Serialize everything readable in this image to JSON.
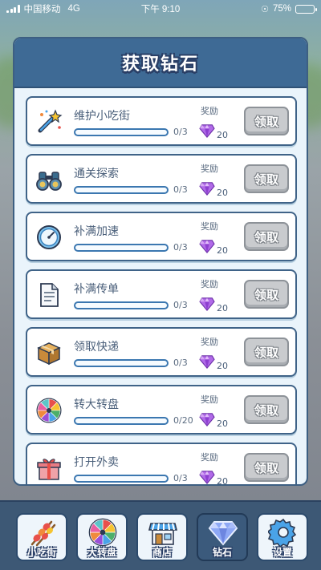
{
  "status_bar": {
    "carrier": "中国移动",
    "network": "4G",
    "time": "下午 9:10",
    "battery": "75%",
    "battery_level": 0.75
  },
  "panel": {
    "title": "获取钻石"
  },
  "tasks": [
    {
      "name": "维护小吃街",
      "progress_text": "0/3",
      "progress": 0,
      "reward_label": "奖励",
      "reward_amount": "20",
      "claim_label": "领取",
      "icon": "magic-wand-icon"
    },
    {
      "name": "通关探索",
      "progress_text": "0/3",
      "progress": 0,
      "reward_label": "奖励",
      "reward_amount": "20",
      "claim_label": "领取",
      "icon": "binoculars-icon"
    },
    {
      "name": "补满加速",
      "progress_text": "0/3",
      "progress": 0,
      "reward_label": "奖励",
      "reward_amount": "20",
      "claim_label": "领取",
      "icon": "speedometer-icon"
    },
    {
      "name": "补满传单",
      "progress_text": "0/3",
      "progress": 0,
      "reward_label": "奖励",
      "reward_amount": "20",
      "claim_label": "领取",
      "icon": "document-icon"
    },
    {
      "name": "领取快递",
      "progress_text": "0/3",
      "progress": 0,
      "reward_label": "奖励",
      "reward_amount": "20",
      "claim_label": "领取",
      "icon": "package-icon"
    },
    {
      "name": "转大转盘",
      "progress_text": "0/20",
      "progress": 0,
      "reward_label": "奖励",
      "reward_amount": "20",
      "claim_label": "领取",
      "icon": "prize-wheel-icon"
    },
    {
      "name": "打开外卖",
      "progress_text": "0/3",
      "progress": 0,
      "reward_label": "奖励",
      "reward_amount": "20",
      "claim_label": "领取",
      "icon": "gift-box-icon"
    }
  ],
  "bottom_nav": [
    {
      "label": "小吃街",
      "icon": "skewer-icon",
      "active": false
    },
    {
      "label": "大转盘",
      "icon": "prize-wheel-icon",
      "active": false
    },
    {
      "label": "商店",
      "icon": "shop-icon",
      "active": false
    },
    {
      "label": "钻石",
      "icon": "diamond-icon",
      "active": true
    },
    {
      "label": "设置",
      "icon": "gear-icon",
      "active": false
    }
  ],
  "colors": {
    "panel_header": "#3e6a95",
    "progress_bar": "#4b9be0",
    "diamond": "#9b4fd6",
    "claim_disabled": "#c9cbce"
  }
}
